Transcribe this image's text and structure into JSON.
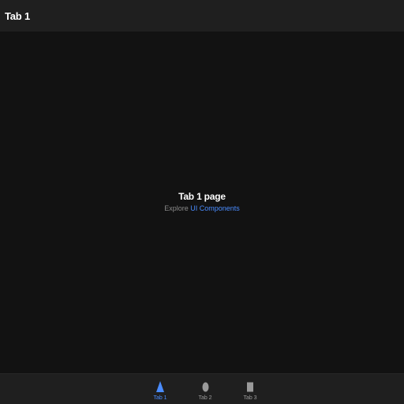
{
  "header": {
    "title": "Tab 1"
  },
  "main": {
    "heading": "Tab 1 page",
    "explore_prefix": "Explore ",
    "explore_link": "UI Components"
  },
  "tabbar": {
    "tabs": [
      {
        "label": "Tab 1",
        "icon": "triangle-icon",
        "active": true
      },
      {
        "label": "Tab 2",
        "icon": "ellipse-icon",
        "active": false
      },
      {
        "label": "Tab 3",
        "icon": "square-icon",
        "active": false
      }
    ]
  },
  "colors": {
    "background": "#121212",
    "bar": "#1f1f1f",
    "accent": "#4a8cff",
    "inactive": "#9a9a9a"
  }
}
